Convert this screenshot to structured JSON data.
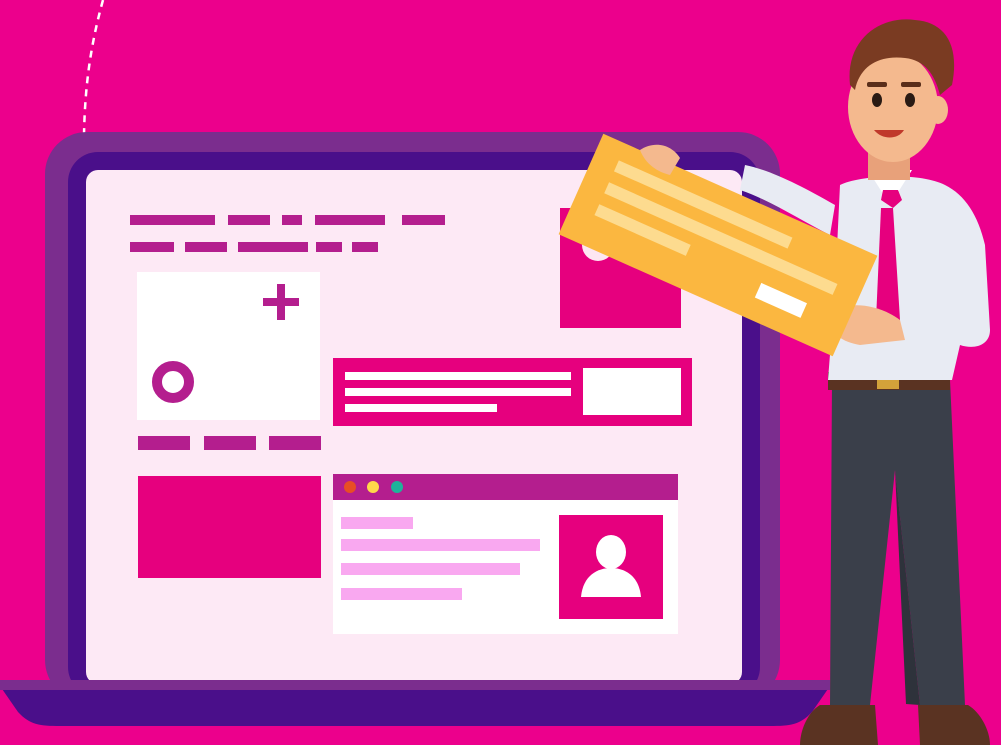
{
  "scene": {
    "title": "",
    "description_visible_text": ""
  },
  "colors": {
    "background": "#ec008c",
    "laptop_frame": "#7b2d8e",
    "laptop_bezel": "#4a0f8a",
    "screen": "#fde9f5",
    "accent_magenta": "#e6007e",
    "accent_purple": "#b41e8e",
    "card_white": "#ffffff",
    "light_pink_text": "#f9a8f0",
    "yellow_card": "#fbb740",
    "shirt": "#e8ebf3",
    "tie": "#e6007e",
    "pants": "#3a3f4a",
    "hair": "#7a3b22",
    "skin": "#f4b98e",
    "dot_red": "#e84e24",
    "dot_yellow": "#ffd94a",
    "dot_teal": "#1fb39a"
  },
  "icons": {
    "plus": "plus-icon",
    "circle": "ring-icon",
    "avatar": "user-avatar-icon",
    "image_placeholder": "image-placeholder-icon"
  }
}
